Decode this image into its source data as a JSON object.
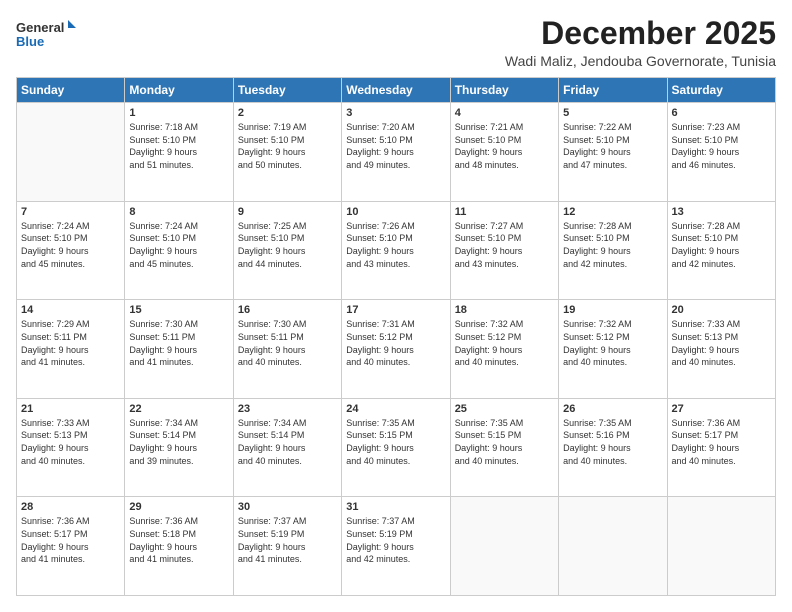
{
  "logo": {
    "line1": "General",
    "line2": "Blue"
  },
  "title": "December 2025",
  "subtitle": "Wadi Maliz, Jendouba Governorate, Tunisia",
  "weekdays": [
    "Sunday",
    "Monday",
    "Tuesday",
    "Wednesday",
    "Thursday",
    "Friday",
    "Saturday"
  ],
  "weeks": [
    [
      {
        "day": "",
        "info": ""
      },
      {
        "day": "1",
        "info": "Sunrise: 7:18 AM\nSunset: 5:10 PM\nDaylight: 9 hours\nand 51 minutes."
      },
      {
        "day": "2",
        "info": "Sunrise: 7:19 AM\nSunset: 5:10 PM\nDaylight: 9 hours\nand 50 minutes."
      },
      {
        "day": "3",
        "info": "Sunrise: 7:20 AM\nSunset: 5:10 PM\nDaylight: 9 hours\nand 49 minutes."
      },
      {
        "day": "4",
        "info": "Sunrise: 7:21 AM\nSunset: 5:10 PM\nDaylight: 9 hours\nand 48 minutes."
      },
      {
        "day": "5",
        "info": "Sunrise: 7:22 AM\nSunset: 5:10 PM\nDaylight: 9 hours\nand 47 minutes."
      },
      {
        "day": "6",
        "info": "Sunrise: 7:23 AM\nSunset: 5:10 PM\nDaylight: 9 hours\nand 46 minutes."
      }
    ],
    [
      {
        "day": "7",
        "info": "Sunrise: 7:24 AM\nSunset: 5:10 PM\nDaylight: 9 hours\nand 45 minutes."
      },
      {
        "day": "8",
        "info": "Sunrise: 7:24 AM\nSunset: 5:10 PM\nDaylight: 9 hours\nand 45 minutes."
      },
      {
        "day": "9",
        "info": "Sunrise: 7:25 AM\nSunset: 5:10 PM\nDaylight: 9 hours\nand 44 minutes."
      },
      {
        "day": "10",
        "info": "Sunrise: 7:26 AM\nSunset: 5:10 PM\nDaylight: 9 hours\nand 43 minutes."
      },
      {
        "day": "11",
        "info": "Sunrise: 7:27 AM\nSunset: 5:10 PM\nDaylight: 9 hours\nand 43 minutes."
      },
      {
        "day": "12",
        "info": "Sunrise: 7:28 AM\nSunset: 5:10 PM\nDaylight: 9 hours\nand 42 minutes."
      },
      {
        "day": "13",
        "info": "Sunrise: 7:28 AM\nSunset: 5:10 PM\nDaylight: 9 hours\nand 42 minutes."
      }
    ],
    [
      {
        "day": "14",
        "info": "Sunrise: 7:29 AM\nSunset: 5:11 PM\nDaylight: 9 hours\nand 41 minutes."
      },
      {
        "day": "15",
        "info": "Sunrise: 7:30 AM\nSunset: 5:11 PM\nDaylight: 9 hours\nand 41 minutes."
      },
      {
        "day": "16",
        "info": "Sunrise: 7:30 AM\nSunset: 5:11 PM\nDaylight: 9 hours\nand 40 minutes."
      },
      {
        "day": "17",
        "info": "Sunrise: 7:31 AM\nSunset: 5:12 PM\nDaylight: 9 hours\nand 40 minutes."
      },
      {
        "day": "18",
        "info": "Sunrise: 7:32 AM\nSunset: 5:12 PM\nDaylight: 9 hours\nand 40 minutes."
      },
      {
        "day": "19",
        "info": "Sunrise: 7:32 AM\nSunset: 5:12 PM\nDaylight: 9 hours\nand 40 minutes."
      },
      {
        "day": "20",
        "info": "Sunrise: 7:33 AM\nSunset: 5:13 PM\nDaylight: 9 hours\nand 40 minutes."
      }
    ],
    [
      {
        "day": "21",
        "info": "Sunrise: 7:33 AM\nSunset: 5:13 PM\nDaylight: 9 hours\nand 40 minutes."
      },
      {
        "day": "22",
        "info": "Sunrise: 7:34 AM\nSunset: 5:14 PM\nDaylight: 9 hours\nand 39 minutes."
      },
      {
        "day": "23",
        "info": "Sunrise: 7:34 AM\nSunset: 5:14 PM\nDaylight: 9 hours\nand 40 minutes."
      },
      {
        "day": "24",
        "info": "Sunrise: 7:35 AM\nSunset: 5:15 PM\nDaylight: 9 hours\nand 40 minutes."
      },
      {
        "day": "25",
        "info": "Sunrise: 7:35 AM\nSunset: 5:15 PM\nDaylight: 9 hours\nand 40 minutes."
      },
      {
        "day": "26",
        "info": "Sunrise: 7:35 AM\nSunset: 5:16 PM\nDaylight: 9 hours\nand 40 minutes."
      },
      {
        "day": "27",
        "info": "Sunrise: 7:36 AM\nSunset: 5:17 PM\nDaylight: 9 hours\nand 40 minutes."
      }
    ],
    [
      {
        "day": "28",
        "info": "Sunrise: 7:36 AM\nSunset: 5:17 PM\nDaylight: 9 hours\nand 41 minutes."
      },
      {
        "day": "29",
        "info": "Sunrise: 7:36 AM\nSunset: 5:18 PM\nDaylight: 9 hours\nand 41 minutes."
      },
      {
        "day": "30",
        "info": "Sunrise: 7:37 AM\nSunset: 5:19 PM\nDaylight: 9 hours\nand 41 minutes."
      },
      {
        "day": "31",
        "info": "Sunrise: 7:37 AM\nSunset: 5:19 PM\nDaylight: 9 hours\nand 42 minutes."
      },
      {
        "day": "",
        "info": ""
      },
      {
        "day": "",
        "info": ""
      },
      {
        "day": "",
        "info": ""
      }
    ]
  ]
}
